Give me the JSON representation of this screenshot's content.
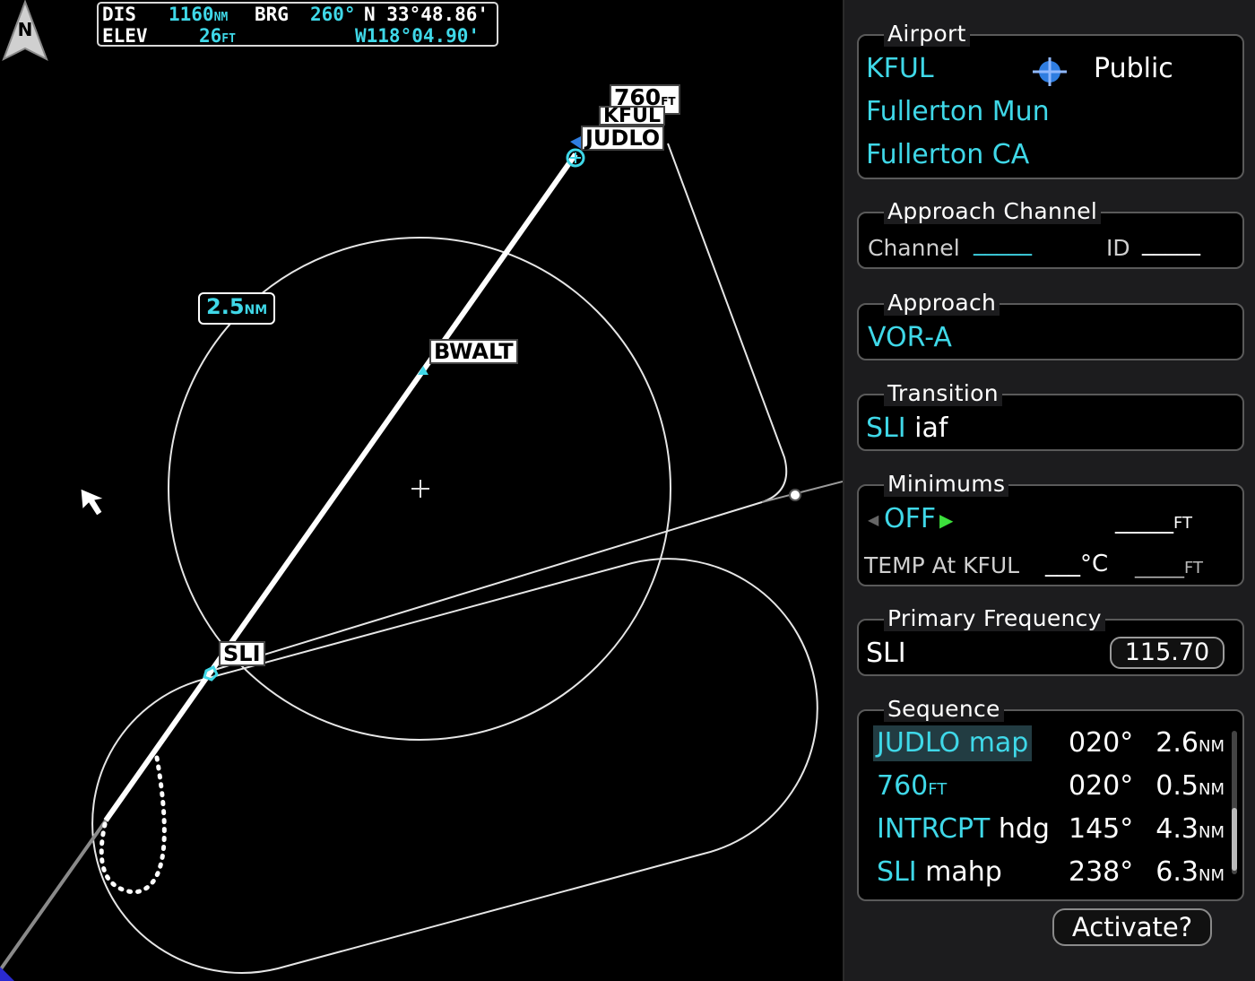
{
  "map": {
    "info": {
      "dis_label": "DIS",
      "dis_value": "1160",
      "dis_unit": "NM",
      "brg_label": "BRG",
      "brg_value": "260°",
      "lat": "N 33°48.86'",
      "elev_label": "ELEV",
      "elev_value": "26",
      "elev_unit": "FT",
      "lon": "W118°04.90'"
    },
    "north_label": "N",
    "range_ring": {
      "value": "2.5",
      "unit": "NM"
    },
    "waypoints": {
      "altitude": {
        "value": "760",
        "unit": "FT"
      },
      "airport": "KFUL",
      "judlo": "JUDLO",
      "bwalt": "BWALT",
      "sli": "SLI"
    }
  },
  "panel": {
    "airport": {
      "title": "Airport",
      "ident": "KFUL",
      "type": "Public",
      "name": "Fullerton Mun",
      "city": "Fullerton CA"
    },
    "approach_channel": {
      "title": "Approach Channel",
      "channel_label": "Channel",
      "channel_value": "_____",
      "id_label": "ID",
      "id_value": "_____"
    },
    "approach": {
      "title": "Approach",
      "value": "VOR-A"
    },
    "transition": {
      "title": "Transition",
      "ident": "SLI",
      "suffix": "iaf"
    },
    "minimums": {
      "title": "Minimums",
      "mode": "OFF",
      "value": "_____",
      "unit": "FT",
      "temp_label": "TEMP At KFUL",
      "temp_value": "___",
      "temp_unit": "°C",
      "temp_alt_value": "_____",
      "temp_alt_unit": "FT"
    },
    "primary_frequency": {
      "title": "Primary Frequency",
      "ident": "SLI",
      "freq": "115.70"
    },
    "sequence": {
      "title": "Sequence",
      "rows": [
        {
          "name": "JUDLO map",
          "name_rest": "",
          "course": "020°",
          "dist": "2.6",
          "unit": "NM"
        },
        {
          "name": "760",
          "name_rest": "FT",
          "course": "020°",
          "dist": "0.5",
          "unit": "NM"
        },
        {
          "name": "INTRCPT",
          "name_rest": "hdg",
          "course": "145°",
          "dist": "4.3",
          "unit": "NM"
        },
        {
          "name": "SLI",
          "name_rest": "mahp",
          "course": "238°",
          "dist": "6.3",
          "unit": "NM"
        }
      ]
    },
    "activate_label": "Activate?"
  },
  "colors": {
    "cyan": "#3fd8e8",
    "green": "#3ce03c",
    "panel_bg": "#1c1c1e"
  }
}
